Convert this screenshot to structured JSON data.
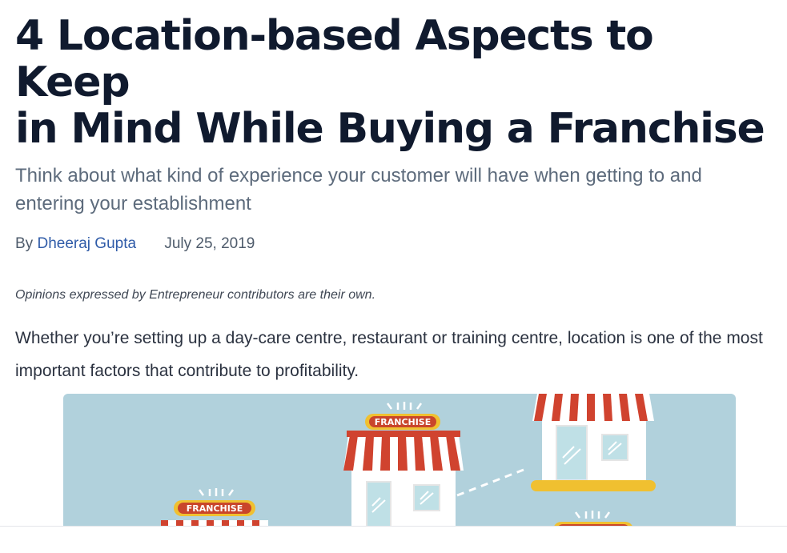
{
  "article": {
    "headline_line1": "4 Location-based Aspects to Keep",
    "headline_line2": "in Mind While Buying a Franchise",
    "subtitle": "Think about what kind of experience your customer will have when getting to and entering your establishment",
    "byline_prefix": "By",
    "author": "Dheeraj Gupta",
    "date": "July 25, 2019",
    "disclaimer": "Opinions expressed by Entrepreneur contributors are their own.",
    "lead": "Whether you’re setting up a day-care centre, restaurant or training centre, location is one of the most important factors that contribute to profitability."
  },
  "hero_image": {
    "sign_text": "FRANCHISE",
    "colors": {
      "background": "#b1d1dc",
      "awning_red": "#d0432f",
      "sign_yellow": "#f0c030",
      "wall": "#ffffff",
      "window": "#bfe0e6"
    }
  }
}
